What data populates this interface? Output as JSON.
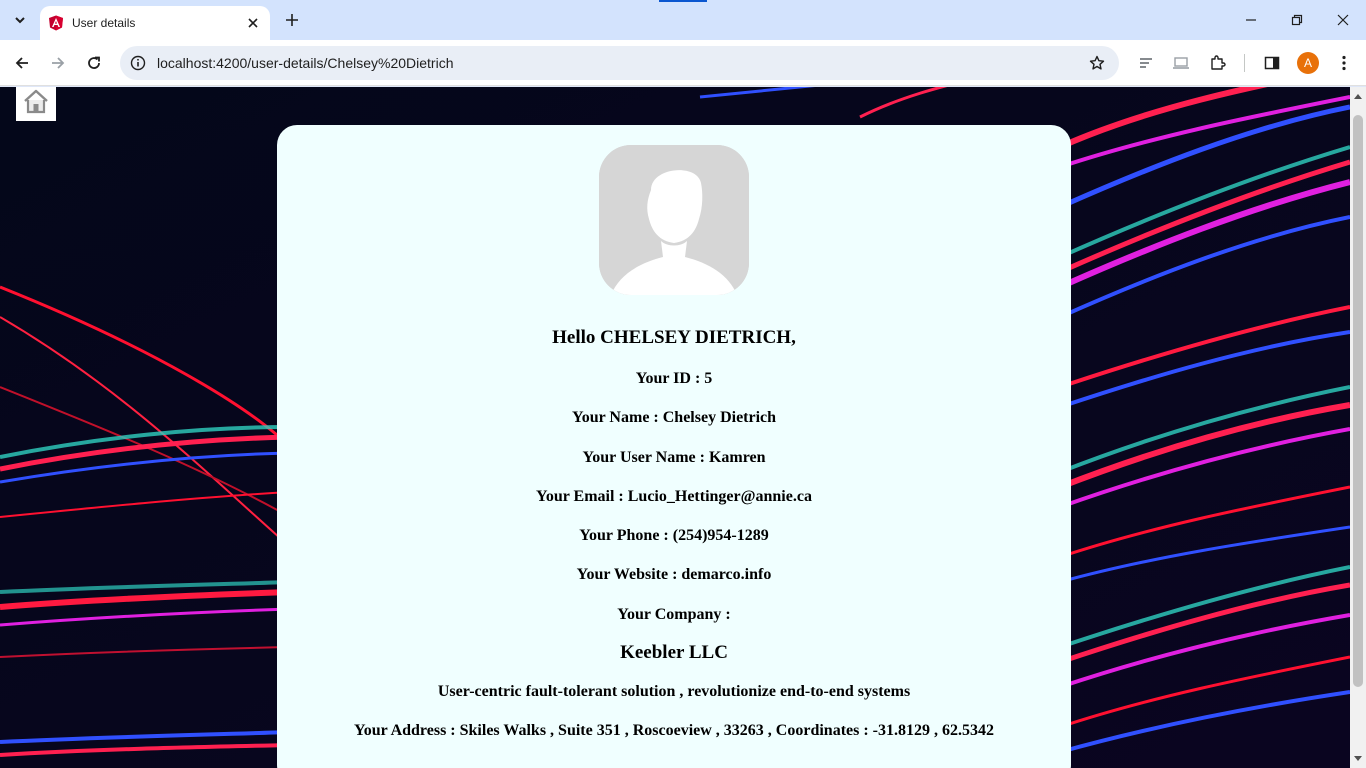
{
  "browser": {
    "tab_title": "User details",
    "url": "localhost:4200/user-details/Chelsey%20Dietrich",
    "profile_initial": "A"
  },
  "colors": {
    "card_background": "#f0ffff",
    "tab_strip": "#d3e3fd",
    "avatar_badge": "#e8710a"
  },
  "icons": {
    "home": "home-icon",
    "profile_photo": "default-user-silhouette"
  },
  "user": {
    "greeting": "Hello CHELSEY DIETRICH,",
    "id_line": "Your ID : 5",
    "name_line": "Your Name : Chelsey Dietrich",
    "username_line": "Your User Name : Kamren",
    "email_line": "Your Email : Lucio_Hettinger@annie.ca",
    "phone_line": "Your Phone : (254)954-1289",
    "website_line": "Your Website : demarco.info",
    "company_label": "Your Company :",
    "company_name": "Keebler LLC",
    "company_catchphrase": "User-centric fault-tolerant solution , revolutionize end-to-end systems",
    "address_line": "Your Address : Skiles Walks , Suite 351 , Roscoeview , 33263 , Coordinates : -31.8129 , 62.5342"
  }
}
